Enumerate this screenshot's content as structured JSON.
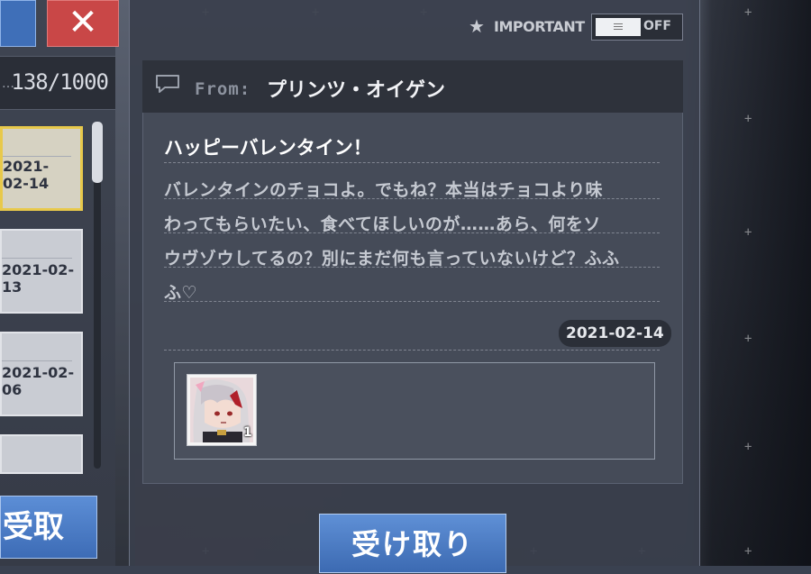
{
  "left_panel": {
    "mail_count": "138/1000",
    "count_prefix": "…",
    "close_icon": "close-icon",
    "mail_items": [
      {
        "date": "2021-02-14",
        "selected": true
      },
      {
        "date": "2021-02-13",
        "selected": false
      },
      {
        "date": "2021-02-06",
        "selected": false
      },
      {
        "date": "",
        "selected": false
      }
    ],
    "claim_all_label": "受取"
  },
  "important": {
    "icon": "star-icon",
    "label": "IMPORTANT",
    "toggle_state": "OFF"
  },
  "mail": {
    "from_label": "From:",
    "sender": "プリンツ・オイゲン",
    "title": "ハッピーバレンタイン！",
    "body_lines": [
      "バレンタインのチョコよ。でもね？本当はチョコより味",
      "わってもらいたい、食べてほしいのが……あら、何をソ",
      "ウヴゾウしてるの？別にまだ何も言っていないけど？ふふ",
      "ふ♡"
    ],
    "date": "2021-02-14",
    "attachment": {
      "icon": "character-avatar-icon",
      "quantity": "1"
    }
  },
  "claim_button_label": "受け取り",
  "colors": {
    "accent_blue": "#4a7cc4",
    "close_red": "#c94747",
    "selected_gold": "#e8c94b",
    "panel_dark": "#2e323b"
  }
}
